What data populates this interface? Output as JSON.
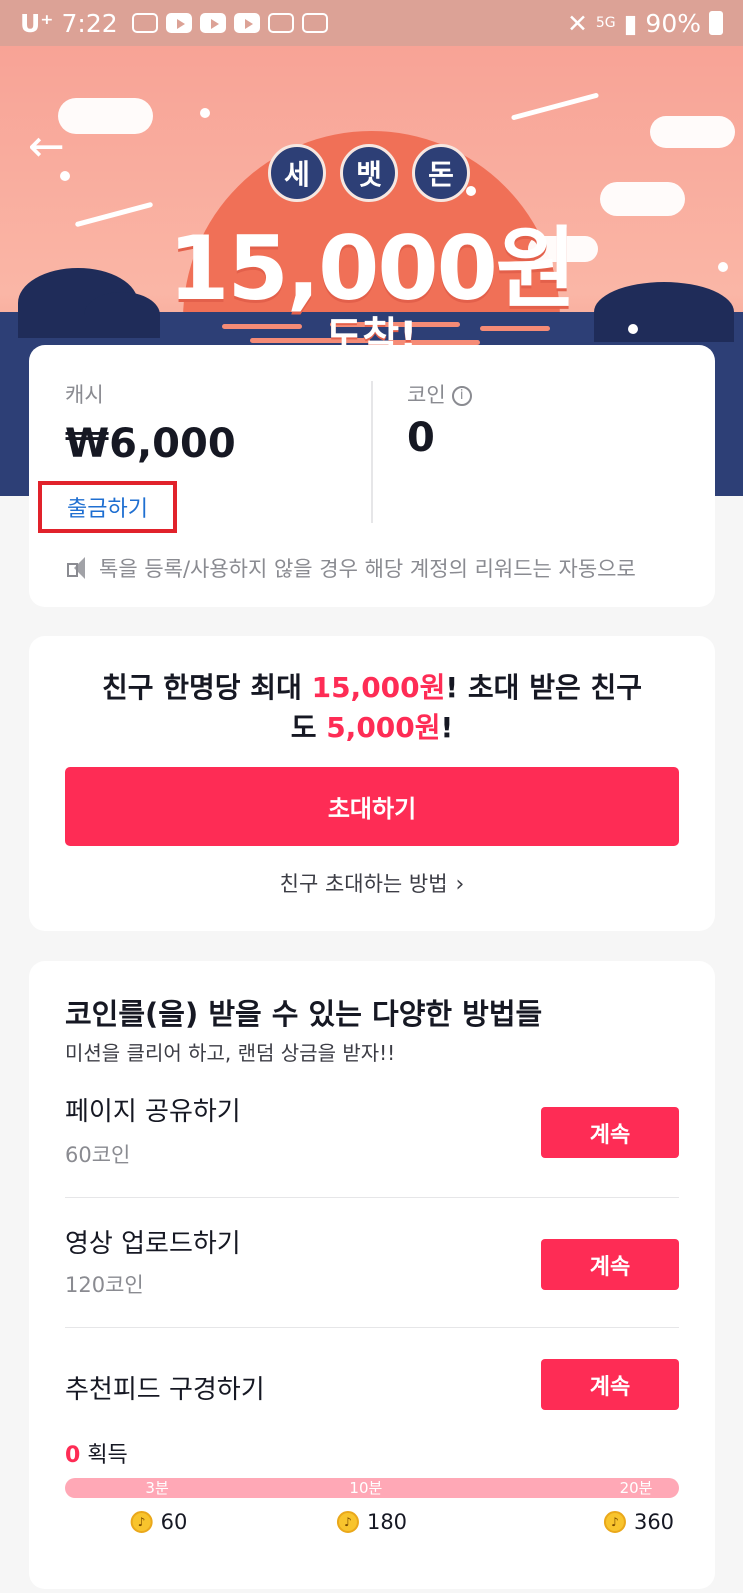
{
  "status_bar": {
    "carrier": "U⁺",
    "time": "7:22",
    "battery": "90%"
  },
  "banner": {
    "seal_chars": [
      "세",
      "뱃",
      "돈"
    ],
    "amount": "15,000원",
    "subtitle": "도착!"
  },
  "wallet": {
    "cash_label": "캐시",
    "cash_value": "₩6,000",
    "withdraw_label": "출금하기",
    "coin_label": "코인",
    "coin_value": "0",
    "notice": "톡을 등록/사용하지 않을 경우 해당 계정의 리워드는 자동으로"
  },
  "invite": {
    "text_part1": "친구 한명당 최대 ",
    "highlight1": "15,000원",
    "text_part2": "! 초대 받은 친구",
    "text_part3": "도 ",
    "highlight2": "5,000원",
    "text_part4": "!",
    "button_label": "초대하기",
    "how_label": "친구 초대하는 방법"
  },
  "earn": {
    "title": "코인를(을) 받을 수 있는 다양한 방법들",
    "subtitle": "미션을 클리어 하고, 랜덤 상금을 받자!!",
    "tasks": [
      {
        "title": "페이지 공유하기",
        "coins": "60코인",
        "button": "계속"
      },
      {
        "title": "영상 업로드하기",
        "coins": "120코인",
        "button": "계속"
      },
      {
        "title": "추천피드 구경하기",
        "coins": "",
        "button": "계속"
      }
    ],
    "obtained_count": "0",
    "obtained_label": "획득",
    "progress_fraction": 0,
    "milestones": [
      {
        "label": "3분",
        "reward": "60"
      },
      {
        "label": "10분",
        "reward": "180"
      },
      {
        "label": "20분",
        "reward": "360"
      }
    ]
  },
  "colors": {
    "accent": "#fe2c55",
    "sea": "#2d3f76",
    "sun": "#f07057",
    "highlight_box": "#e1222b"
  }
}
